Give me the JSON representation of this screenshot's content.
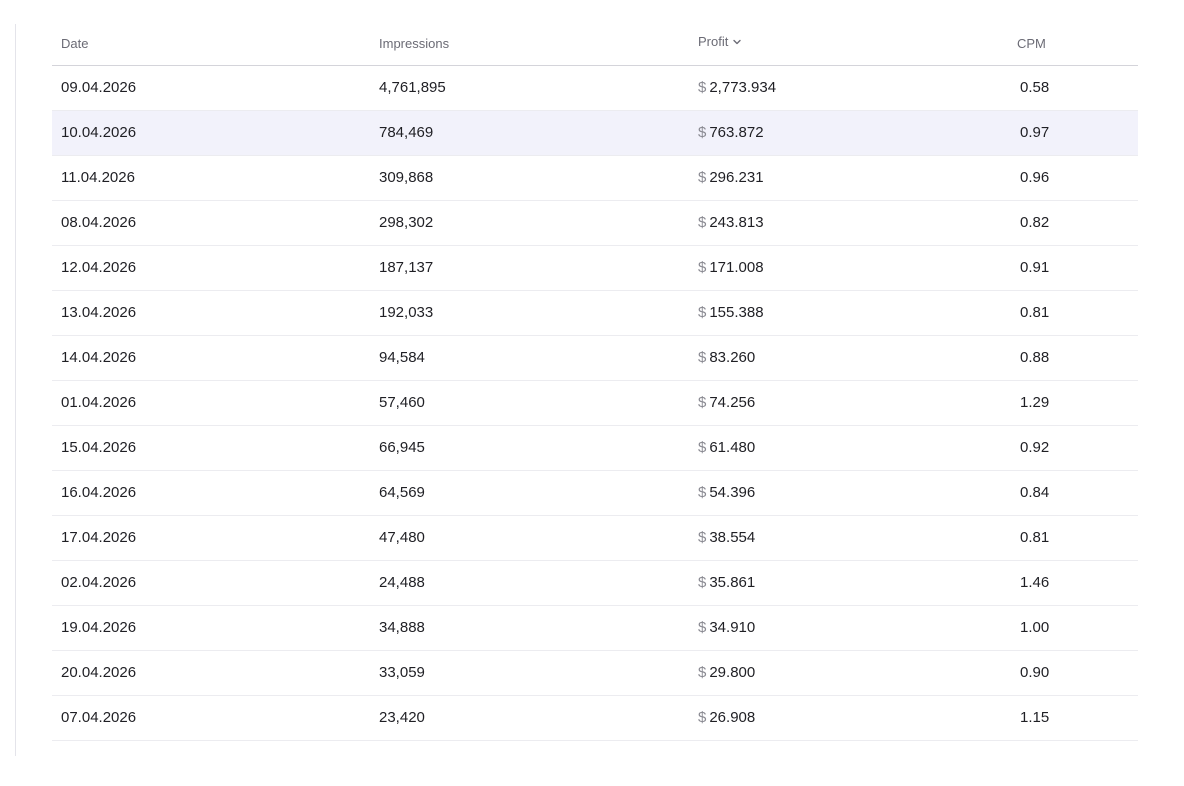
{
  "table": {
    "headers": {
      "date": "Date",
      "impressions": "Impressions",
      "profit": "Profit",
      "cpm": "CPM"
    },
    "sort_column": "profit",
    "sort_icon": "chevron-down-icon",
    "highlighted_row_index": 1,
    "currency_symbol": "$",
    "rows": [
      {
        "date": "09.04.2026",
        "impressions": "4,761,895",
        "profit": "2,773.934",
        "cpm": "0.58"
      },
      {
        "date": "10.04.2026",
        "impressions": "784,469",
        "profit": "763.872",
        "cpm": "0.97"
      },
      {
        "date": "11.04.2026",
        "impressions": "309,868",
        "profit": "296.231",
        "cpm": "0.96"
      },
      {
        "date": "08.04.2026",
        "impressions": "298,302",
        "profit": "243.813",
        "cpm": "0.82"
      },
      {
        "date": "12.04.2026",
        "impressions": "187,137",
        "profit": "171.008",
        "cpm": "0.91"
      },
      {
        "date": "13.04.2026",
        "impressions": "192,033",
        "profit": "155.388",
        "cpm": "0.81"
      },
      {
        "date": "14.04.2026",
        "impressions": "94,584",
        "profit": "83.260",
        "cpm": "0.88"
      },
      {
        "date": "01.04.2026",
        "impressions": "57,460",
        "profit": "74.256",
        "cpm": "1.29"
      },
      {
        "date": "15.04.2026",
        "impressions": "66,945",
        "profit": "61.480",
        "cpm": "0.92"
      },
      {
        "date": "16.04.2026",
        "impressions": "64,569",
        "profit": "54.396",
        "cpm": "0.84"
      },
      {
        "date": "17.04.2026",
        "impressions": "47,480",
        "profit": "38.554",
        "cpm": "0.81"
      },
      {
        "date": "02.04.2026",
        "impressions": "24,488",
        "profit": "35.861",
        "cpm": "1.46"
      },
      {
        "date": "19.04.2026",
        "impressions": "34,888",
        "profit": "34.910",
        "cpm": "1.00"
      },
      {
        "date": "20.04.2026",
        "impressions": "33,059",
        "profit": "29.800",
        "cpm": "0.90"
      },
      {
        "date": "07.04.2026",
        "impressions": "23,420",
        "profit": "26.908",
        "cpm": "1.15"
      }
    ]
  },
  "colors": {
    "row_highlight": "#f2f2fb",
    "header_text": "#6b6b75",
    "currency_text": "#8a8a92"
  }
}
